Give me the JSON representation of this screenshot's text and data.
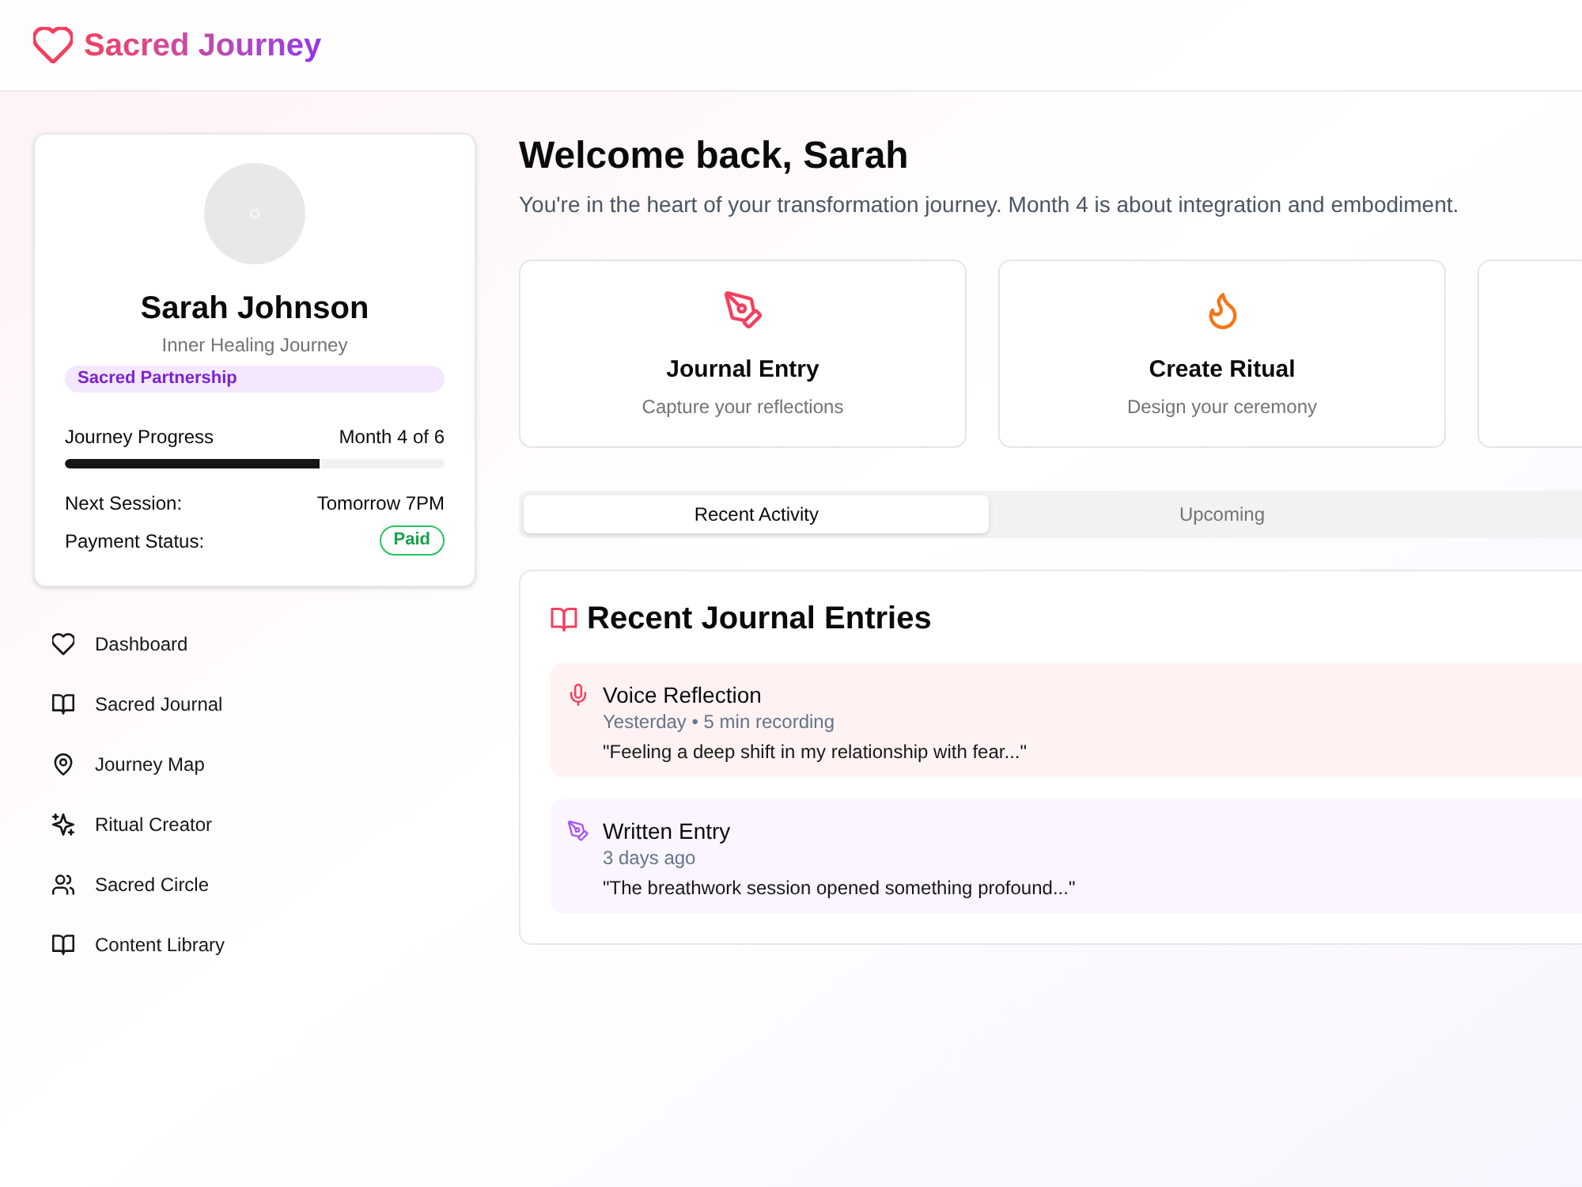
{
  "header": {
    "app_name": "Sacred Journey"
  },
  "profile": {
    "name": "Sarah Johnson",
    "subtitle": "Inner Healing Journey",
    "badge": "Sacred Partnership",
    "progress": {
      "label": "Journey Progress",
      "value": "Month 4 of 6",
      "level": 0.67
    },
    "details": [
      {
        "kind": "text",
        "label": "Next Session:",
        "value": "Tomorrow 7PM"
      },
      {
        "kind": "badge",
        "label": "Payment Status:",
        "value": "Paid"
      }
    ]
  },
  "sidebar": {
    "items": [
      {
        "kind": "heart",
        "label": "Dashboard"
      },
      {
        "kind": "book",
        "label": "Sacred Journal"
      },
      {
        "kind": "pin",
        "label": "Journey Map"
      },
      {
        "kind": "sparkles",
        "label": "Ritual Creator"
      },
      {
        "kind": "people",
        "label": "Sacred Circle"
      },
      {
        "kind": "book",
        "label": "Content Library"
      }
    ]
  },
  "welcome": {
    "title": "Welcome back, Sarah",
    "subtitle": "You're in the heart of your transformation journey. Month 4 is about integration and embodiment."
  },
  "quick_actions": [
    {
      "kind": "journal",
      "title": "Journal Entry",
      "description": "Capture your reflections"
    },
    {
      "kind": "ritual",
      "title": "Create Ritual",
      "description": "Design your ceremony"
    },
    {
      "kind": "blank"
    }
  ],
  "tabs": [
    {
      "label": "Recent Activity",
      "selected": true
    },
    {
      "label": "Upcoming",
      "selected": false
    }
  ],
  "journal": {
    "title": "Recent Journal Entries",
    "entries": [
      {
        "kind": "voice",
        "title": "Voice Reflection",
        "meta": "Yesterday • 5 min recording",
        "excerpt": "\"Feeling a deep shift in my relationship with fear...\""
      },
      {
        "kind": "written",
        "title": "Written Entry",
        "meta": "3 days ago",
        "excerpt": "\"The breathwork session opened something profound...\""
      }
    ]
  }
}
